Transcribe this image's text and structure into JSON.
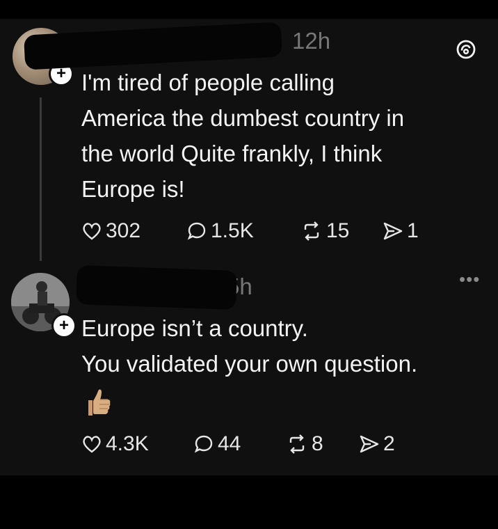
{
  "post1": {
    "time": "12h",
    "text": "I'm tired of people calling\nAmerica the dumbest country in\nthe world Quite frankly, I think\nEurope is!",
    "likes": "302",
    "replies": "1.5K",
    "reposts": "15",
    "shares": "1"
  },
  "post2": {
    "time": "5h",
    "text": "Europe isn’t a country.\nYou validated your own question.",
    "emoji_icon": "thumbs-up-emoji",
    "likes": "4.3K",
    "replies": "44",
    "reposts": "8",
    "shares": "2"
  },
  "icons": {
    "app": "threads-logo-icon",
    "like": "heart-icon",
    "reply": "comment-icon",
    "repost": "repost-icon",
    "share": "send-icon",
    "more": "more-options-icon"
  },
  "colors": {
    "background": "#101010",
    "text": "#f3f3f3",
    "muted": "#777777"
  }
}
